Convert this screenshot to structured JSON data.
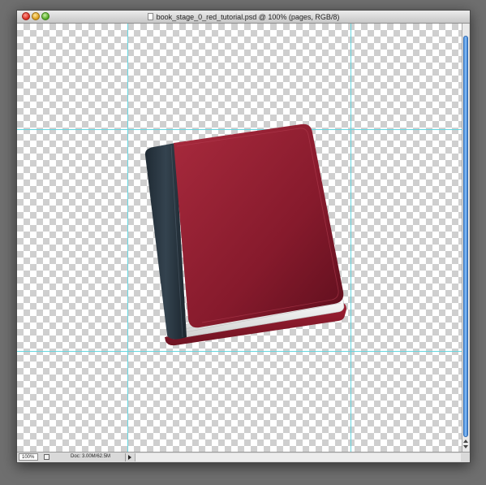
{
  "window": {
    "title": "book_stage_0_red_tutorial.psd @ 100% (pages, RGB/8)"
  },
  "statusbar": {
    "zoom": "100%",
    "doc_size": "Doc: 3.00M/62.5M"
  },
  "canvas": {
    "guide_color": "#66d6e0",
    "artwork": {
      "cover_color": "#8e1b2e",
      "spine_color": "#26323c",
      "pages_color": "#f2f2f2"
    }
  },
  "icons": [
    "close-icon",
    "minimize-icon",
    "zoom-icon",
    "document-icon",
    "disclosure-arrow-icon"
  ]
}
